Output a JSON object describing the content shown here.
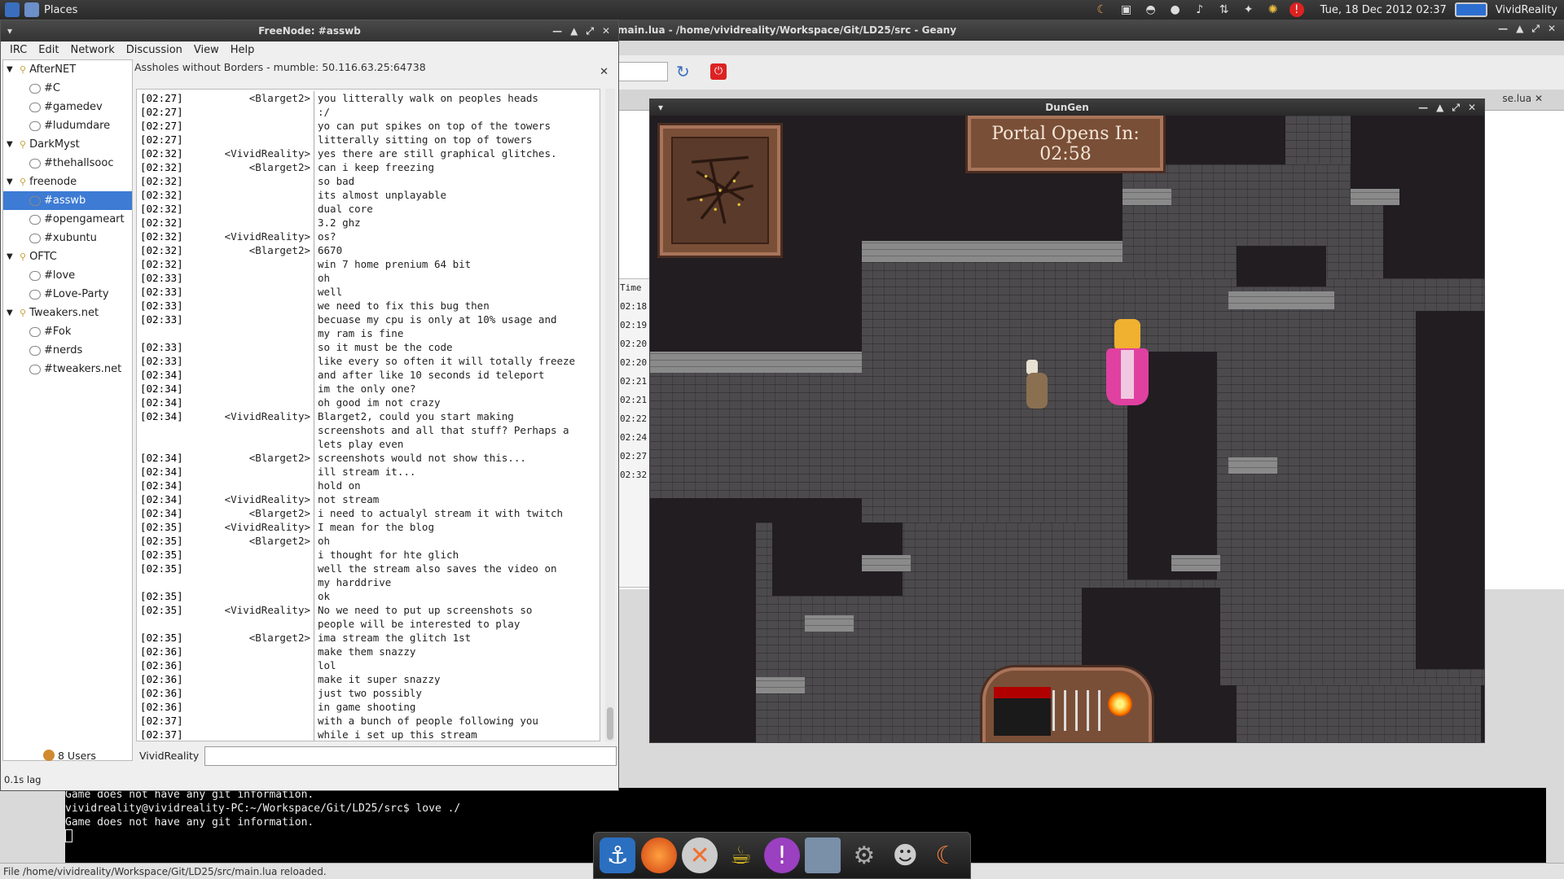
{
  "top_panel": {
    "places_label": "Places",
    "clock": "Tue, 18 Dec 2012 02:37",
    "user": "VividReality"
  },
  "geany": {
    "title": "main.lua - /home/vividreality/Workspace/Git/LD25/src - Geany",
    "tab_right": "se.lua",
    "sidebar_header": "Time",
    "sidebar_times": [
      "02:18",
      "02:19",
      "02:20",
      "02:20",
      "02:21",
      "02:21",
      "02:22",
      "02:24",
      "02:27",
      "02:32"
    ],
    "terminal_lines": [
      "Game does not have any git information.",
      "vividreality@vividreality-PC:~/Workspace/Git/LD25/src$ love ./",
      "Game does not have any git information."
    ],
    "status": "File /home/vividreality/Workspace/Git/LD25/src/main.lua reloaded."
  },
  "xchat": {
    "title": "FreeNode: #asswb",
    "menu": [
      "IRC",
      "Edit",
      "Network",
      "Discussion",
      "View",
      "Help"
    ],
    "tree": [
      {
        "type": "net",
        "label": "AfterNET"
      },
      {
        "type": "chan",
        "label": "#C"
      },
      {
        "type": "chan",
        "label": "#gamedev"
      },
      {
        "type": "chan",
        "label": "#ludumdare"
      },
      {
        "type": "net",
        "label": "DarkMyst"
      },
      {
        "type": "chan",
        "label": "#thehallsooc"
      },
      {
        "type": "net",
        "label": "freenode"
      },
      {
        "type": "chan",
        "label": "#asswb",
        "selected": true
      },
      {
        "type": "chan",
        "label": "#opengameart"
      },
      {
        "type": "chan",
        "label": "#xubuntu"
      },
      {
        "type": "net",
        "label": "OFTC"
      },
      {
        "type": "chan",
        "label": "#love"
      },
      {
        "type": "chan",
        "label": "#Love-Party"
      },
      {
        "type": "net",
        "label": "Tweakers.net"
      },
      {
        "type": "chan",
        "label": "#Fok"
      },
      {
        "type": "chan",
        "label": "#nerds"
      },
      {
        "type": "chan",
        "label": "#tweakers.net"
      }
    ],
    "topic": "Assholes without Borders - mumble: 50.116.63.25:64738",
    "log": [
      [
        "[02:27]",
        "<Blarget2>",
        "you litterally walk on peoples heads"
      ],
      [
        "[02:27]",
        "",
        ":/"
      ],
      [
        "[02:27]",
        "",
        "yo can put spikes on top of the towers"
      ],
      [
        "[02:27]",
        "",
        "litterally sitting on top of towers"
      ],
      [
        "[02:32]",
        "<VividReality>",
        "yes there are still graphical glitches."
      ],
      [
        "[02:32]",
        "<Blarget2>",
        "can i keep freezing"
      ],
      [
        "[02:32]",
        "",
        "so bad"
      ],
      [
        "[02:32]",
        "",
        "its almost unplayable"
      ],
      [
        "[02:32]",
        "",
        "dual core"
      ],
      [
        "[02:32]",
        "",
        "3.2 ghz"
      ],
      [
        "[02:32]",
        "<VividReality>",
        "os?"
      ],
      [
        "[02:32]",
        "<Blarget2>",
        "6670"
      ],
      [
        "[02:32]",
        "",
        "win 7 home prenium 64 bit"
      ],
      [
        "[02:33]",
        "",
        "oh"
      ],
      [
        "[02:33]",
        "",
        "well"
      ],
      [
        "[02:33]",
        "",
        "we need to fix this bug then"
      ],
      [
        "[02:33]",
        "",
        "becuase my cpu is only at 10% usage and\nmy ram is fine"
      ],
      [
        "[02:33]",
        "",
        "so it must be the code"
      ],
      [
        "[02:33]",
        "",
        "like every so often it will totally freeze"
      ],
      [
        "[02:34]",
        "",
        "and after like 10 seconds id teleport"
      ],
      [
        "[02:34]",
        "",
        "im the only one?"
      ],
      [
        "[02:34]",
        "",
        "oh good im not crazy"
      ],
      [
        "[02:34]",
        "<VividReality>",
        "Blarget2, could you start making\nscreenshots and all that stuff? Perhaps a\nlets play even"
      ],
      [
        "[02:34]",
        "<Blarget2>",
        "screenshots would not show this..."
      ],
      [
        "[02:34]",
        "",
        "ill stream it..."
      ],
      [
        "[02:34]",
        "",
        "hold on"
      ],
      [
        "[02:34]",
        "<VividReality>",
        "not stream"
      ],
      [
        "[02:34]",
        "<Blarget2>",
        "i need to actualyl stream it with twitch"
      ],
      [
        "[02:35]",
        "<VividReality>",
        "I mean for the blog"
      ],
      [
        "[02:35]",
        "<Blarget2>",
        "oh"
      ],
      [
        "[02:35]",
        "",
        "i thought for hte glich"
      ],
      [
        "[02:35]",
        "",
        "well the stream also saves the video on\nmy harddrive"
      ],
      [
        "[02:35]",
        "",
        "ok"
      ],
      [
        "[02:35]",
        "<VividReality>",
        "No we need to put up screenshots so\npeople will be interested to play"
      ],
      [
        "[02:35]",
        "<Blarget2>",
        "ima stream the glitch 1st"
      ],
      [
        "[02:36]",
        "",
        "make them snazzy"
      ],
      [
        "[02:36]",
        "",
        "lol"
      ],
      [
        "[02:36]",
        "",
        "make it super snazzy"
      ],
      [
        "[02:36]",
        "",
        "just two possibly"
      ],
      [
        "[02:36]",
        "",
        "in game shooting"
      ],
      [
        "[02:37]",
        "",
        "with a bunch of people following you"
      ],
      [
        "[02:37]",
        "",
        "while i set up this stream"
      ]
    ],
    "user_count": "8 Users",
    "nick": "VividReality",
    "lag": "0.1s lag"
  },
  "dungen": {
    "title": "DunGen",
    "portal_line1": "Portal Opens In:",
    "portal_line2": "02:58"
  },
  "dock": {
    "items": [
      "anchor-icon",
      "firefox-icon",
      "x-tool-icon",
      "teapot-icon",
      "notify-icon",
      "folder-icon",
      "settings-icon",
      "gimp-icon",
      "love-icon"
    ]
  }
}
